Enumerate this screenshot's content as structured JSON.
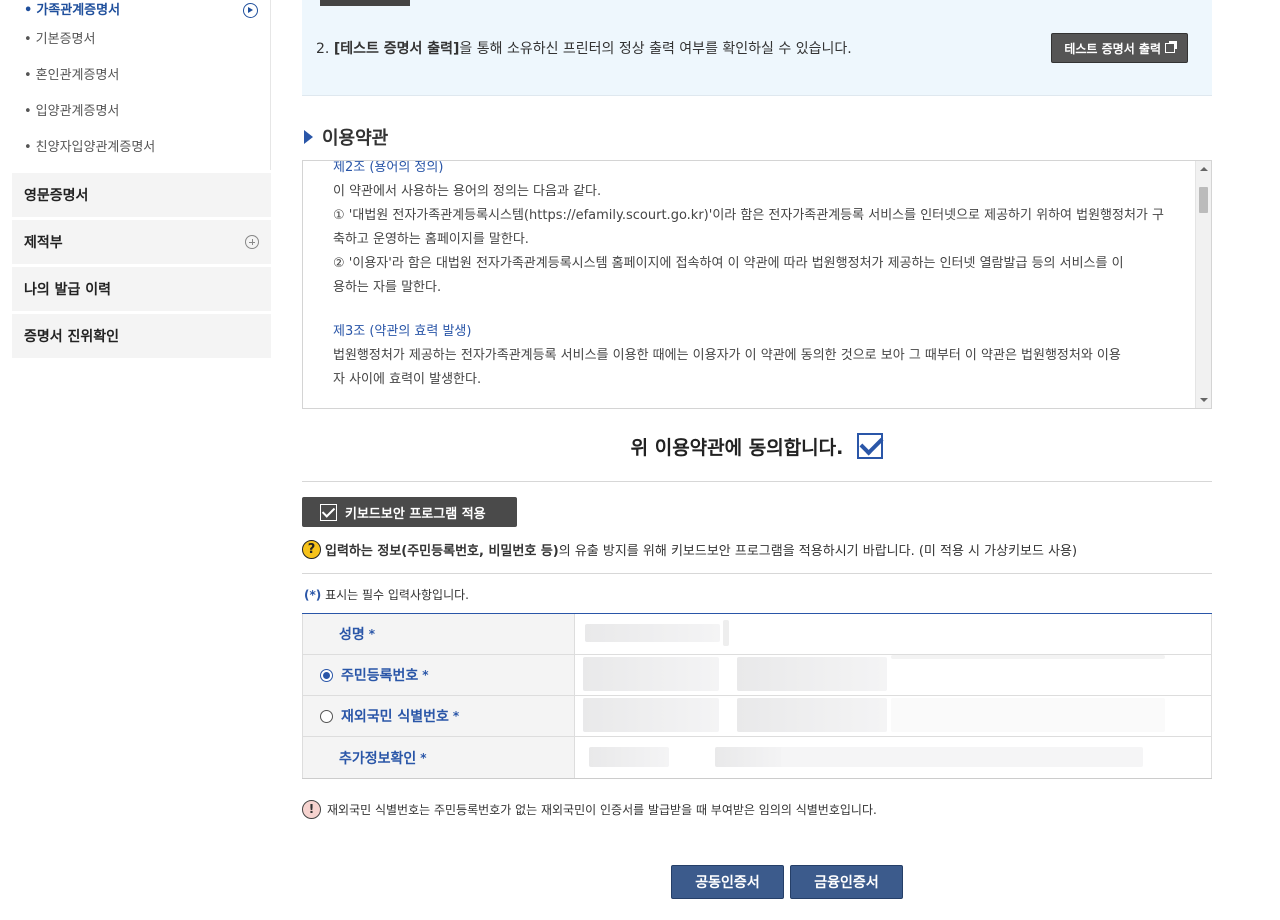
{
  "sidebar": {
    "active_item": "가족관계증명서",
    "sub_items": [
      "기본증명서",
      "혼인관계증명서",
      "입양관계증명서",
      "친양자입양관계증명서"
    ],
    "menu": [
      "영문증명서",
      "제적부",
      "나의 발급 이력",
      "증명서 진위확인"
    ]
  },
  "notice": {
    "line2_prefix": "2. ",
    "line2_bold": "[테스트 증명서 출력]",
    "line2_rest": "을 통해 소유하신 프린터의 정상 출력 여부를 확인하실 수 있습니다.",
    "test_button": "테스트 증명서 출력"
  },
  "terms": {
    "title": "이용약관",
    "art2_title": "제2조 (용어의 정의)",
    "art2_intro": "이 약관에서 사용하는 용어의 정의는 다음과 같다.",
    "art2_p1a": "① '대법원 전자가족관계등록시스템(https://efamily.scourt.go.kr)'이라 함은 전자가족관계등록 서비스를 인터넷으로 제공하기 위하여 법원행정처가 구",
    "art2_p1b": "축하고 운영하는 홈페이지를 말한다.",
    "art2_p2a": "② '이용자'라 함은 대법원 전자가족관계등록시스템 홈페이지에 접속하여 이 약관에 따라 법원행정처가 제공하는 인터넷 열람발급 등의 서비스를 이",
    "art2_p2b": "용하는 자를 말한다.",
    "art3_title": "제3조 (약관의 효력 발생)",
    "art3_p1a": "법원행정처가 제공하는 전자가족관계등록 서비스를 이용한 때에는 이용자가 이 약관에 동의한 것으로 보아 그 때부터 이 약관은 법원행정처와 이용",
    "art3_p1b": "자 사이에 효력이 발생한다."
  },
  "agree": {
    "label": "위 이용약관에 동의합니다.",
    "checked": true
  },
  "keyboard": {
    "button": "키보드보안 프로그램 적용",
    "note_bold": "입력하는 정보(주민등록번호, 비밀번호 등)",
    "note_rest": "의 유출 방지를 위해 키보드보안 프로그램을 적용하시기 바랍니다. (미 적용 시 가상키보드 사용)"
  },
  "form": {
    "required_note_mark": "(*)",
    "required_note": " 표시는 필수 입력사항입니다.",
    "star": "*",
    "rows": [
      {
        "label": "성명"
      },
      {
        "label": "주민등록번호",
        "radio": true,
        "selected": true
      },
      {
        "label": "재외국민 식별번호",
        "radio": true,
        "selected": false
      },
      {
        "label": "추가정보확인"
      }
    ]
  },
  "warning": "재외국민 식별번호는 주민등록번호가 없는 재외국민이 인증서를 발급받을 때 부여받은 임의의 식별번호입니다.",
  "buttons": {
    "joint_cert": "공동인증서",
    "financial_cert": "금융인증서"
  },
  "colors": {
    "accent": "#2a56a8",
    "button_dark": "#4a4a4a",
    "cert_button": "#3c5b8c",
    "notice_bg": "#eef7fd"
  }
}
